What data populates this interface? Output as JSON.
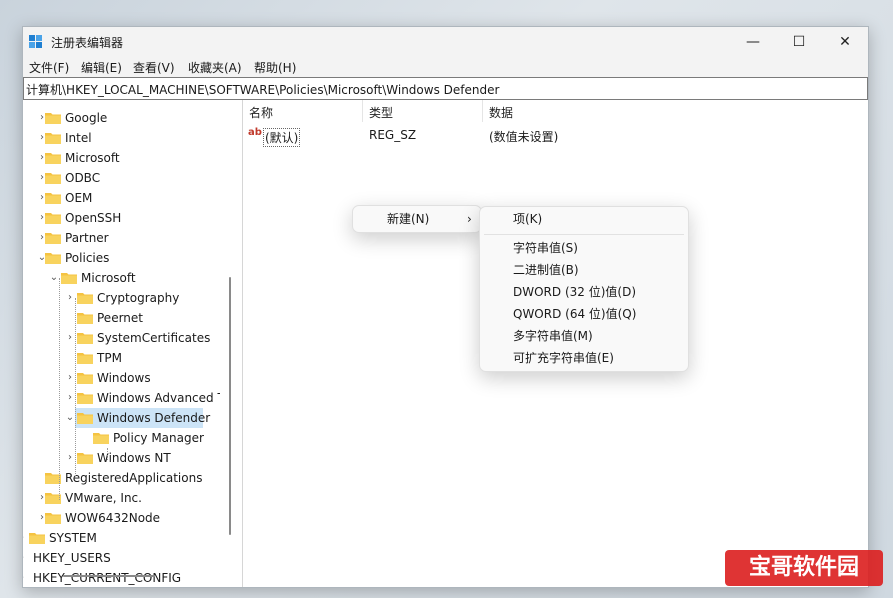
{
  "window": {
    "title": "注册表编辑器",
    "minimize": "—",
    "maximize": "☐",
    "close": "✕"
  },
  "menu": [
    "文件(F)",
    "编辑(E)",
    "查看(V)",
    "收藏夹(A)",
    "帮助(H)"
  ],
  "address": "计算机\\HKEY_LOCAL_MACHINE\\SOFTWARE\\Policies\\Microsoft\\Windows Defender",
  "tree": [
    {
      "label": "Google",
      "level": 0,
      "expander": "›"
    },
    {
      "label": "Intel",
      "level": 0,
      "expander": "›"
    },
    {
      "label": "Microsoft",
      "level": 0,
      "expander": "›"
    },
    {
      "label": "ODBC",
      "level": 0,
      "expander": "›"
    },
    {
      "label": "OEM",
      "level": 0,
      "expander": "›"
    },
    {
      "label": "OpenSSH",
      "level": 0,
      "expander": "›"
    },
    {
      "label": "Partner",
      "level": 0,
      "expander": "›"
    },
    {
      "label": "Policies",
      "level": 0,
      "expander": "⌄"
    },
    {
      "label": "Microsoft",
      "level": 1,
      "expander": "⌄"
    },
    {
      "label": "Cryptography",
      "level": 2,
      "expander": "›"
    },
    {
      "label": "Peernet",
      "level": 2,
      "expander": ""
    },
    {
      "label": "SystemCertificates",
      "level": 2,
      "expander": "›"
    },
    {
      "label": "TPM",
      "level": 2,
      "expander": ""
    },
    {
      "label": "Windows",
      "level": 2,
      "expander": "›"
    },
    {
      "label": "Windows Advanced T",
      "level": 2,
      "expander": "›"
    },
    {
      "label": "Windows Defender",
      "level": 2,
      "expander": "⌄",
      "selected": true
    },
    {
      "label": "Policy Manager",
      "level": 3,
      "expander": ""
    },
    {
      "label": "Windows NT",
      "level": 2,
      "expander": "›"
    },
    {
      "label": "RegisteredApplications",
      "level": 0,
      "expander": ""
    },
    {
      "label": "VMware, Inc.",
      "level": 0,
      "expander": "›"
    },
    {
      "label": "WOW6432Node",
      "level": 0,
      "expander": "›"
    },
    {
      "label": "SYSTEM",
      "level": -1,
      "expander": "›"
    },
    {
      "label": "HKEY_USERS",
      "level": -2,
      "expander": "›"
    },
    {
      "label": "HKEY_CURRENT_CONFIG",
      "level": -2,
      "expander": "›"
    }
  ],
  "list": {
    "columns": [
      "名称",
      "类型",
      "数据"
    ],
    "rows": [
      {
        "icon": "ab",
        "name": "(默认)",
        "type": "REG_SZ",
        "data": "(数值未设置)"
      }
    ]
  },
  "context_menu": {
    "new_label": "新建(N)",
    "arrow": "›"
  },
  "submenu": [
    "项(K)",
    "字符串值(S)",
    "二进制值(B)",
    "DWORD (32 位)值(D)",
    "QWORD (64 位)值(Q)",
    "多字符串值(M)",
    "可扩充字符串值(E)"
  ],
  "watermark": "宝哥软件园",
  "colors": {
    "folder": "#f5c342",
    "selection": "#cce4f7",
    "watermark": "#dc1e1e"
  }
}
